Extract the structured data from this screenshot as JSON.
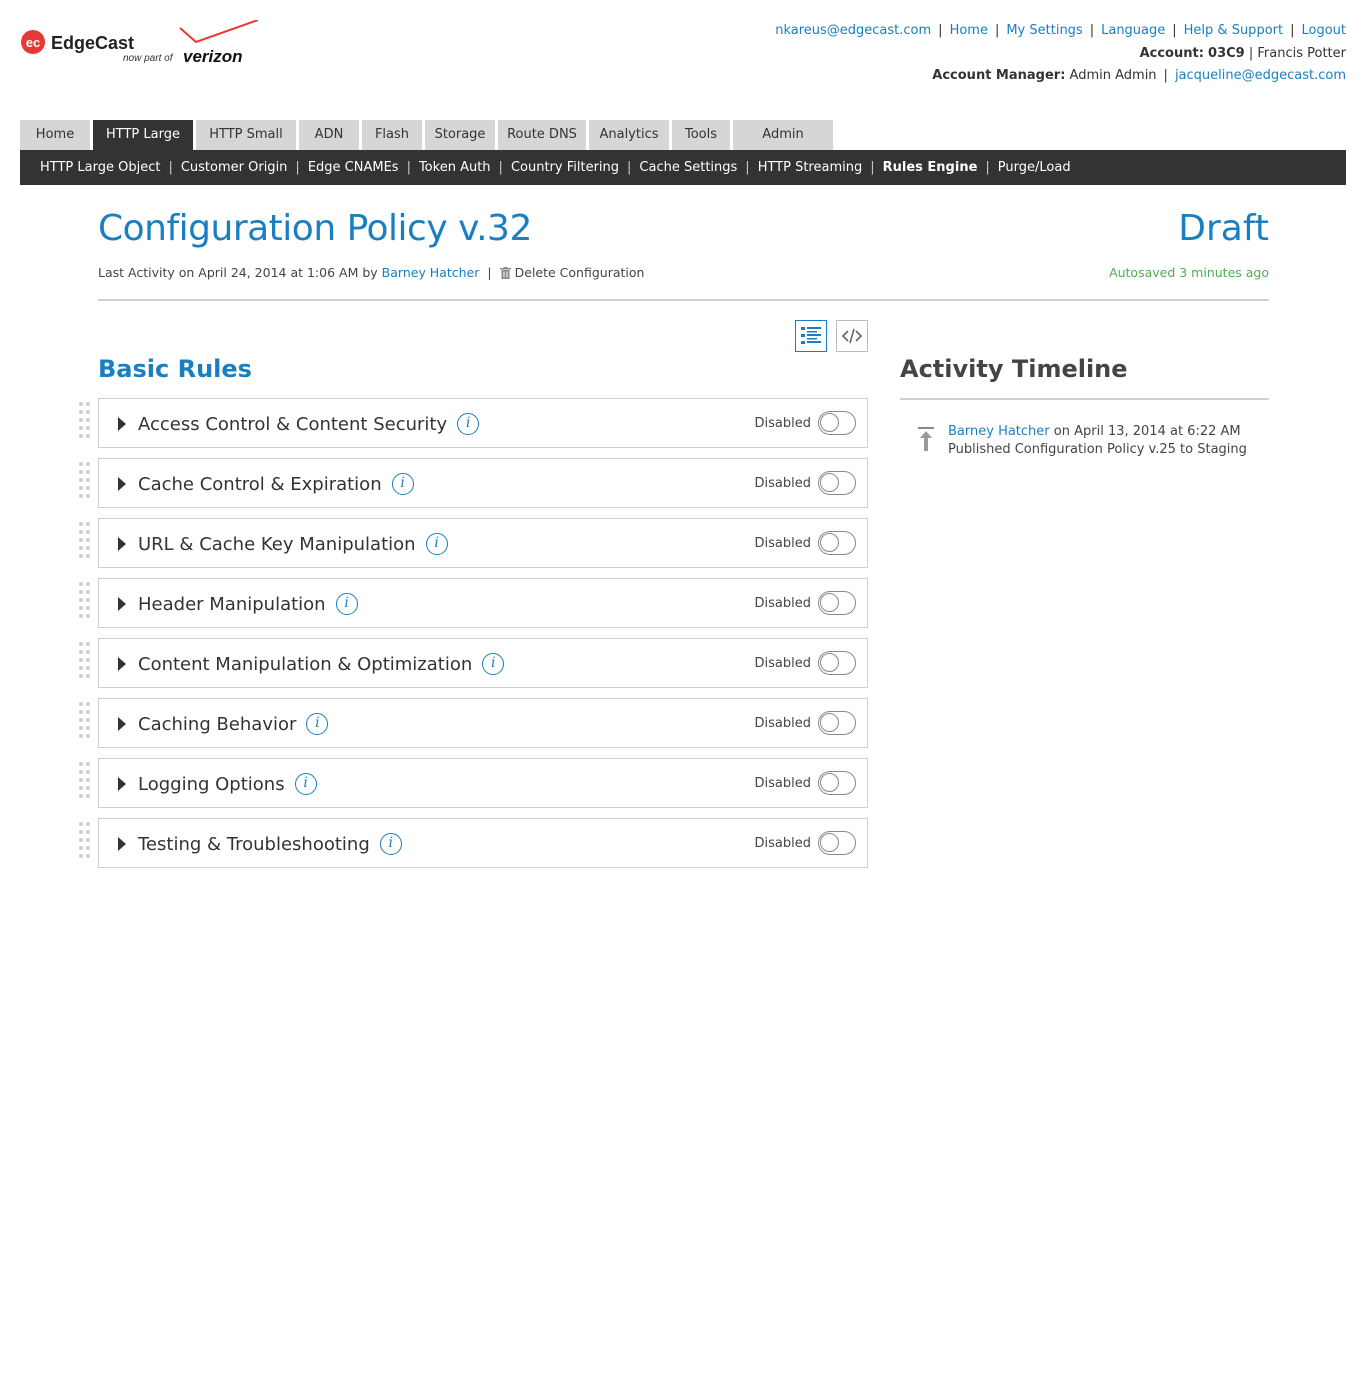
{
  "brand": {
    "name": "EdgeCast",
    "mark": "ec",
    "tagline": "now part of",
    "partner": "verizon",
    "accent": "#e53935",
    "verizon_check": "#e53935"
  },
  "top_links": {
    "email": "nkareus@edgecast.com",
    "home": "Home",
    "my_settings": "My Settings",
    "language": "Language",
    "help": "Help & Support",
    "logout": "Logout",
    "account_label": "Account:",
    "account_id": "03C9",
    "account_name": "Francis Potter",
    "manager_label": "Account Manager:",
    "manager_name": "Admin Admin",
    "manager_email": "jacqueline@edgecast.com"
  },
  "main_tabs": [
    {
      "label": "Home",
      "active": false
    },
    {
      "label": "HTTP Large",
      "active": true
    },
    {
      "label": "HTTP Small",
      "active": false
    },
    {
      "label": "ADN",
      "active": false
    },
    {
      "label": "Flash",
      "active": false
    },
    {
      "label": "Storage",
      "active": false
    },
    {
      "label": "Route DNS",
      "active": false
    },
    {
      "label": "Analytics",
      "active": false
    },
    {
      "label": "Tools",
      "active": false
    },
    {
      "label": "Admin",
      "active": false
    }
  ],
  "sub_nav": [
    {
      "label": "HTTP Large Object",
      "active": false
    },
    {
      "label": "Customer Origin",
      "active": false
    },
    {
      "label": "Edge CNAMEs",
      "active": false
    },
    {
      "label": "Token Auth",
      "active": false
    },
    {
      "label": "Country Filtering",
      "active": false
    },
    {
      "label": "Cache Settings",
      "active": false
    },
    {
      "label": "HTTP Streaming",
      "active": false
    },
    {
      "label": "Rules Engine",
      "active": true
    },
    {
      "label": "Purge/Load",
      "active": false
    }
  ],
  "policy": {
    "title": "Configuration Policy v.32",
    "state": "Draft",
    "last_activity_prefix": "Last Activity on April 24, 2014 at 1:06 AM by",
    "last_activity_user": "Barney Hatcher",
    "delete_label": "Delete Configuration",
    "autosaved": "Autosaved 3 minutes ago"
  },
  "view_toggle": {
    "list_icon": "list-view-icon",
    "code_icon": "code-view-icon",
    "active": "list"
  },
  "basic_rules": {
    "title": "Basic Rules",
    "items": [
      {
        "label": "Access Control & Content Security",
        "status": "Disabled",
        "enabled": false
      },
      {
        "label": "Cache Control & Expiration",
        "status": "Disabled",
        "enabled": false
      },
      {
        "label": "URL & Cache Key Manipulation",
        "status": "Disabled",
        "enabled": false
      },
      {
        "label": "Header Manipulation",
        "status": "Disabled",
        "enabled": false
      },
      {
        "label": "Content Manipulation & Optimization",
        "status": "Disabled",
        "enabled": false
      },
      {
        "label": "Caching Behavior",
        "status": "Disabled",
        "enabled": false
      },
      {
        "label": "Logging Options",
        "status": "Disabled",
        "enabled": false
      },
      {
        "label": "Testing & Troubleshooting",
        "status": "Disabled",
        "enabled": false
      }
    ]
  },
  "timeline": {
    "title": "Activity Timeline",
    "entries": [
      {
        "user": "Barney Hatcher",
        "when": "on April 13, 2014 at 6:22 AM",
        "action": "Published Configuration Policy v.25 to Staging",
        "icon": "publish-icon"
      }
    ]
  },
  "colors": {
    "link": "#1a7fc1",
    "nav_dark": "#333333",
    "tab_inactive": "#d6d6d6",
    "autosaved_green": "#4caf50"
  }
}
